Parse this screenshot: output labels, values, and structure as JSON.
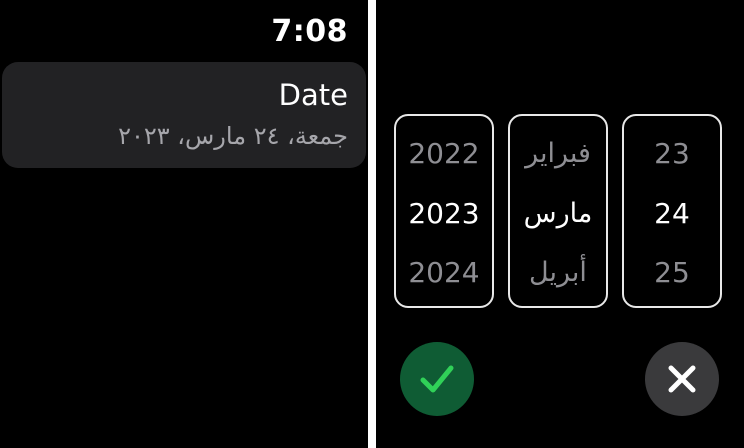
{
  "left_screen": {
    "time": "7:08",
    "date_cell": {
      "title": "Date",
      "value": "جمعة، ٢٤ مارس، ٢٠٢٣"
    }
  },
  "right_screen": {
    "pickers": {
      "year": {
        "prev": "2022",
        "current": "2023",
        "next": "2024"
      },
      "month": {
        "prev": "فبراير",
        "current": "مارس",
        "next": "أبريل"
      },
      "day": {
        "prev": "23",
        "current": "24",
        "next": "25"
      }
    },
    "buttons": {
      "confirm_icon": "checkmark-icon",
      "cancel_icon": "close-icon"
    }
  },
  "colors": {
    "background": "#000000",
    "cell": "#222224",
    "secondary_text": "#a6a6ab",
    "confirm": "#0f5c34",
    "confirm_check": "#30d158",
    "cancel": "#3a3a3c"
  }
}
